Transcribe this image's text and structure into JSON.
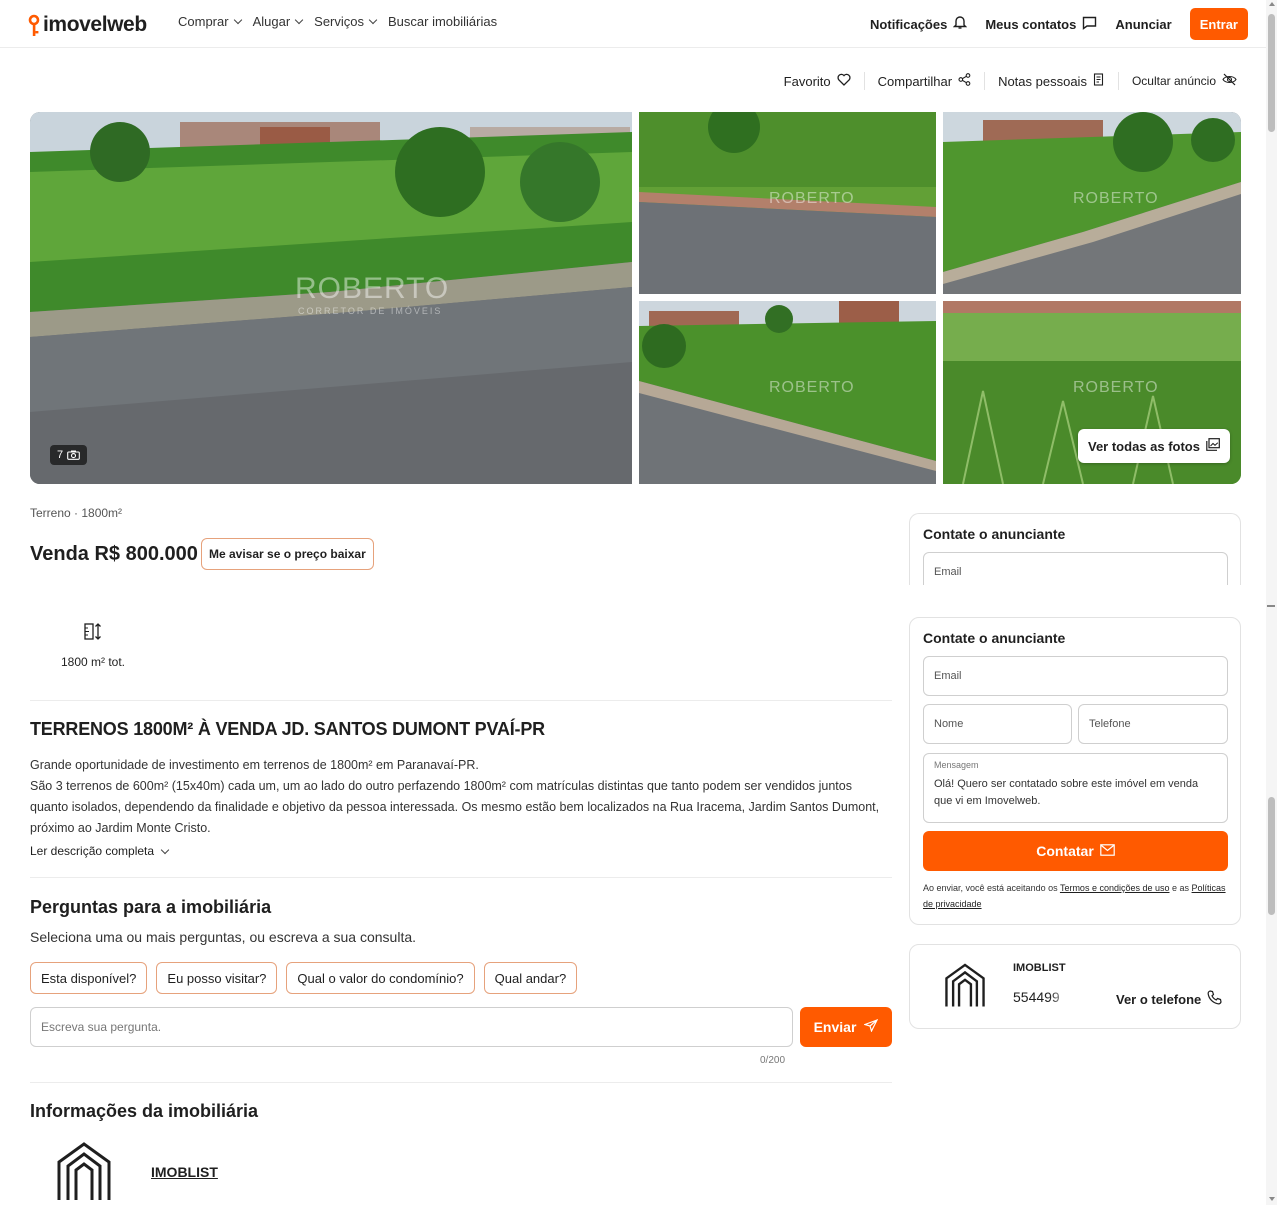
{
  "header": {
    "logo": "imovelweb",
    "nav": [
      {
        "label": "Comprar",
        "dropdown": true
      },
      {
        "label": "Alugar",
        "dropdown": true
      },
      {
        "label": "Serviços",
        "dropdown": true
      },
      {
        "label": "Buscar imobiliárias",
        "dropdown": false
      }
    ],
    "notifications": "Notificações",
    "contacts": "Meus contatos",
    "announce": "Anunciar",
    "login": "Entrar"
  },
  "actions": {
    "favorite": "Favorito",
    "share": "Compartilhar",
    "notes": "Notas pessoais",
    "hide": "Ocultar anúncio"
  },
  "gallery": {
    "photo_count": "7",
    "watermark": "ROBERTO",
    "watermark_sub": "CORRETOR DE IMÓVEIS",
    "see_all": "Ver todas as fotos"
  },
  "listing": {
    "subtype": "Terreno · 1800m²",
    "price": "Venda R$ 800.000",
    "price_alert": "Me avisar se o preço baixar",
    "feature_area": "1800 m² tot.",
    "title": "TERRENOS 1800M² À VENDA JD. SANTOS DUMONT PVAÍ-PR",
    "description_1": "Grande oportunidade de investimento em terrenos de 1800m² em Paranavaí-PR.",
    "description_2": "São 3 terrenos de 600m² (15x40m) cada um, um ao lado do outro perfazendo 1800m² com matrículas distintas que tanto podem ser vendidos juntos quanto isolados, dependendo da finalidade e objetivo da pessoa interessada. Os mesmo estão bem localizados na Rua Iracema, Jardim Santos Dumont, próximo ao Jardim Monte Cristo.",
    "read_more": "Ler descrição completa"
  },
  "questions": {
    "title": "Perguntas para a imobiliária",
    "subtitle": "Seleciona uma ou mais perguntas, ou escreva a sua consulta.",
    "chips": [
      "Esta disponível?",
      "Eu posso visitar?",
      "Qual o valor do condomínio?",
      "Qual andar?"
    ],
    "placeholder": "Escreva sua pergunta.",
    "send": "Enviar",
    "counter": "0/200"
  },
  "agency_info": {
    "title": "Informações da imobiliária",
    "name": "IMOBLIST"
  },
  "contact": {
    "title": "Contate o anunciante",
    "email_placeholder": "Email",
    "name_placeholder": "Nome",
    "phone_placeholder": "Telefone",
    "message_label": "Mensagem",
    "message_text": "Olá! Quero ser contatado sobre este imóvel em venda que vi em Imovelweb.",
    "submit": "Contatar",
    "terms_prefix": "Ao enviar, você está aceitando os",
    "terms_link": "Termos e condições de uso",
    "terms_mid": "e as",
    "privacy_link": "Políticas de privacidade"
  },
  "agent": {
    "name": "IMOBLIST",
    "phone_partial": "554499",
    "show_phone": "Ver o telefone"
  },
  "colors": {
    "accent": "#ff5a00",
    "chip_border": "#e6a27c"
  }
}
